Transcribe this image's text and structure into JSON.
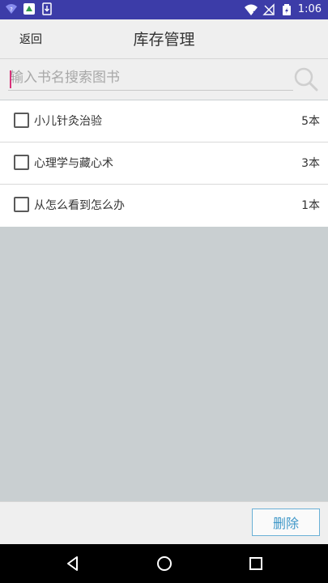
{
  "status_bar": {
    "time": "1:06",
    "icons": [
      "wifi-question-icon",
      "app-notification-icon",
      "download-icon",
      "wifi-icon",
      "no-signal-icon",
      "battery-charging-icon"
    ]
  },
  "header": {
    "back_label": "返回",
    "title": "库存管理"
  },
  "search": {
    "placeholder": "输入书名搜索图书",
    "value": "",
    "icon": "search-icon"
  },
  "books": [
    {
      "name": "小儿针灸治验",
      "count": "5本",
      "checked": false
    },
    {
      "name": "心理学与藏心术",
      "count": "3本",
      "checked": false
    },
    {
      "name": "从怎么看到怎么办",
      "count": "1本",
      "checked": false
    }
  ],
  "footer": {
    "delete_label": "删除"
  },
  "colors": {
    "status_bar": "#3c3ca8",
    "accent": "#3f97c8",
    "cursor": "#d8327a",
    "empty_area": "#c9cfd1"
  },
  "nav_bar": {
    "icons": [
      "back-triangle-icon",
      "home-circle-icon",
      "recents-square-icon"
    ]
  }
}
